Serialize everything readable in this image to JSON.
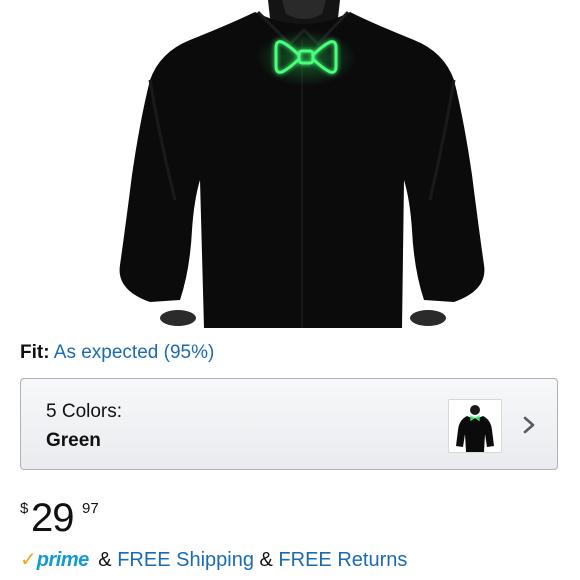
{
  "product": {
    "image_alt": "Man wearing dark shirt with glowing green bow tie"
  },
  "fit": {
    "label": "Fit:",
    "value": "As expected (95%)"
  },
  "colors": {
    "count_label": "5 Colors:",
    "selected": "Green",
    "thumbnail_icon": "product-thumbnail",
    "chevron_icon": "chevron-right-icon"
  },
  "price": {
    "symbol": "$",
    "whole": "29",
    "fraction": "97"
  },
  "shipping": {
    "prime_check": "✓",
    "prime_word": "prime",
    "amp1": "&",
    "free_shipping": "FREE Shipping",
    "amp2": "&",
    "free_returns": "FREE Returns"
  },
  "theme": {
    "link_color": "#1a6bb0",
    "prime_blue": "#1399d3",
    "prime_orange": "#f7a21b",
    "glow_green": "#3dff6a",
    "shirt_black": "#0b0b0c"
  }
}
